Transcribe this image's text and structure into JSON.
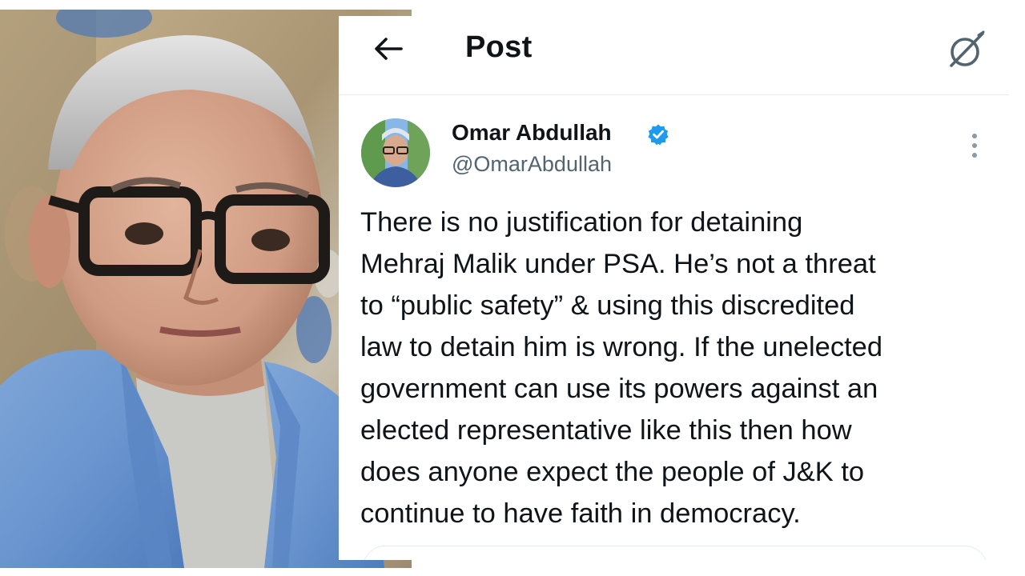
{
  "photo": {
    "subject_icon": "portrait-photo"
  },
  "topbar": {
    "back_icon": "arrow-left-icon",
    "title": "Post",
    "grok_icon": "grok-icon"
  },
  "tweet": {
    "author": {
      "name": "Omar Abdullah",
      "handle": "@OmarAbdullah",
      "verified": true,
      "verified_color": "#1d9bf0"
    },
    "lines": [
      "There is no justification for detaining",
      "Mehraj Malik under PSA. He’s not a threat",
      "to “public safety” & using this discredited",
      "law to detain him is wrong. If the unelected",
      "government can use its powers against an",
      "elected representative like this then how",
      "does anyone expect the people of J&K to",
      "continue to have faith in democracy."
    ],
    "more_icon": "more-vertical-icon"
  },
  "colors": {
    "text_primary": "#0f1419",
    "text_secondary": "#536471",
    "accent": "#1d9bf0",
    "divider": "#e6ecf0"
  }
}
